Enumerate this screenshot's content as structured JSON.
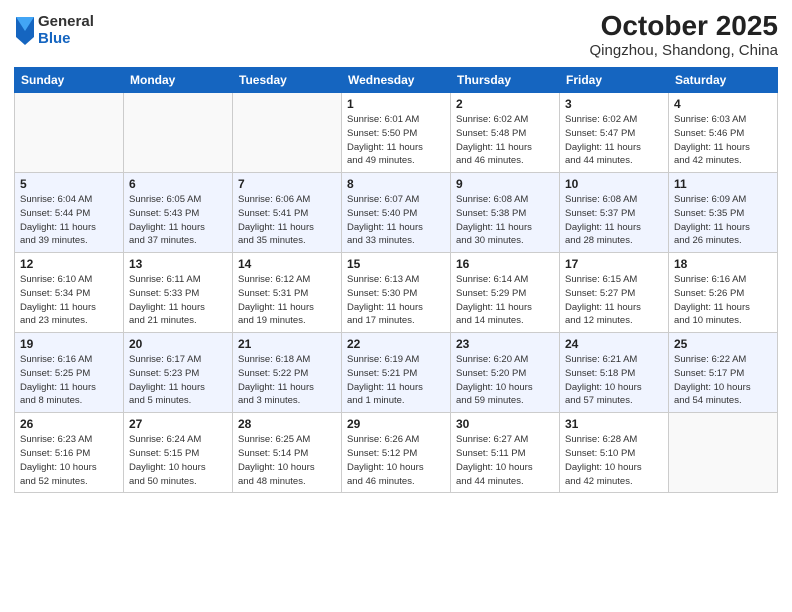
{
  "header": {
    "logo_general": "General",
    "logo_blue": "Blue",
    "title": "October 2025",
    "subtitle": "Qingzhou, Shandong, China"
  },
  "calendar": {
    "days_of_week": [
      "Sunday",
      "Monday",
      "Tuesday",
      "Wednesday",
      "Thursday",
      "Friday",
      "Saturday"
    ],
    "weeks": [
      {
        "days": [
          {
            "num": "",
            "info": ""
          },
          {
            "num": "",
            "info": ""
          },
          {
            "num": "",
            "info": ""
          },
          {
            "num": "1",
            "info": "Sunrise: 6:01 AM\nSunset: 5:50 PM\nDaylight: 11 hours\nand 49 minutes."
          },
          {
            "num": "2",
            "info": "Sunrise: 6:02 AM\nSunset: 5:48 PM\nDaylight: 11 hours\nand 46 minutes."
          },
          {
            "num": "3",
            "info": "Sunrise: 6:02 AM\nSunset: 5:47 PM\nDaylight: 11 hours\nand 44 minutes."
          },
          {
            "num": "4",
            "info": "Sunrise: 6:03 AM\nSunset: 5:46 PM\nDaylight: 11 hours\nand 42 minutes."
          }
        ]
      },
      {
        "days": [
          {
            "num": "5",
            "info": "Sunrise: 6:04 AM\nSunset: 5:44 PM\nDaylight: 11 hours\nand 39 minutes."
          },
          {
            "num": "6",
            "info": "Sunrise: 6:05 AM\nSunset: 5:43 PM\nDaylight: 11 hours\nand 37 minutes."
          },
          {
            "num": "7",
            "info": "Sunrise: 6:06 AM\nSunset: 5:41 PM\nDaylight: 11 hours\nand 35 minutes."
          },
          {
            "num": "8",
            "info": "Sunrise: 6:07 AM\nSunset: 5:40 PM\nDaylight: 11 hours\nand 33 minutes."
          },
          {
            "num": "9",
            "info": "Sunrise: 6:08 AM\nSunset: 5:38 PM\nDaylight: 11 hours\nand 30 minutes."
          },
          {
            "num": "10",
            "info": "Sunrise: 6:08 AM\nSunset: 5:37 PM\nDaylight: 11 hours\nand 28 minutes."
          },
          {
            "num": "11",
            "info": "Sunrise: 6:09 AM\nSunset: 5:35 PM\nDaylight: 11 hours\nand 26 minutes."
          }
        ]
      },
      {
        "days": [
          {
            "num": "12",
            "info": "Sunrise: 6:10 AM\nSunset: 5:34 PM\nDaylight: 11 hours\nand 23 minutes."
          },
          {
            "num": "13",
            "info": "Sunrise: 6:11 AM\nSunset: 5:33 PM\nDaylight: 11 hours\nand 21 minutes."
          },
          {
            "num": "14",
            "info": "Sunrise: 6:12 AM\nSunset: 5:31 PM\nDaylight: 11 hours\nand 19 minutes."
          },
          {
            "num": "15",
            "info": "Sunrise: 6:13 AM\nSunset: 5:30 PM\nDaylight: 11 hours\nand 17 minutes."
          },
          {
            "num": "16",
            "info": "Sunrise: 6:14 AM\nSunset: 5:29 PM\nDaylight: 11 hours\nand 14 minutes."
          },
          {
            "num": "17",
            "info": "Sunrise: 6:15 AM\nSunset: 5:27 PM\nDaylight: 11 hours\nand 12 minutes."
          },
          {
            "num": "18",
            "info": "Sunrise: 6:16 AM\nSunset: 5:26 PM\nDaylight: 11 hours\nand 10 minutes."
          }
        ]
      },
      {
        "days": [
          {
            "num": "19",
            "info": "Sunrise: 6:16 AM\nSunset: 5:25 PM\nDaylight: 11 hours\nand 8 minutes."
          },
          {
            "num": "20",
            "info": "Sunrise: 6:17 AM\nSunset: 5:23 PM\nDaylight: 11 hours\nand 5 minutes."
          },
          {
            "num": "21",
            "info": "Sunrise: 6:18 AM\nSunset: 5:22 PM\nDaylight: 11 hours\nand 3 minutes."
          },
          {
            "num": "22",
            "info": "Sunrise: 6:19 AM\nSunset: 5:21 PM\nDaylight: 11 hours\nand 1 minute."
          },
          {
            "num": "23",
            "info": "Sunrise: 6:20 AM\nSunset: 5:20 PM\nDaylight: 10 hours\nand 59 minutes."
          },
          {
            "num": "24",
            "info": "Sunrise: 6:21 AM\nSunset: 5:18 PM\nDaylight: 10 hours\nand 57 minutes."
          },
          {
            "num": "25",
            "info": "Sunrise: 6:22 AM\nSunset: 5:17 PM\nDaylight: 10 hours\nand 54 minutes."
          }
        ]
      },
      {
        "days": [
          {
            "num": "26",
            "info": "Sunrise: 6:23 AM\nSunset: 5:16 PM\nDaylight: 10 hours\nand 52 minutes."
          },
          {
            "num": "27",
            "info": "Sunrise: 6:24 AM\nSunset: 5:15 PM\nDaylight: 10 hours\nand 50 minutes."
          },
          {
            "num": "28",
            "info": "Sunrise: 6:25 AM\nSunset: 5:14 PM\nDaylight: 10 hours\nand 48 minutes."
          },
          {
            "num": "29",
            "info": "Sunrise: 6:26 AM\nSunset: 5:12 PM\nDaylight: 10 hours\nand 46 minutes."
          },
          {
            "num": "30",
            "info": "Sunrise: 6:27 AM\nSunset: 5:11 PM\nDaylight: 10 hours\nand 44 minutes."
          },
          {
            "num": "31",
            "info": "Sunrise: 6:28 AM\nSunset: 5:10 PM\nDaylight: 10 hours\nand 42 minutes."
          },
          {
            "num": "",
            "info": ""
          }
        ]
      }
    ]
  }
}
